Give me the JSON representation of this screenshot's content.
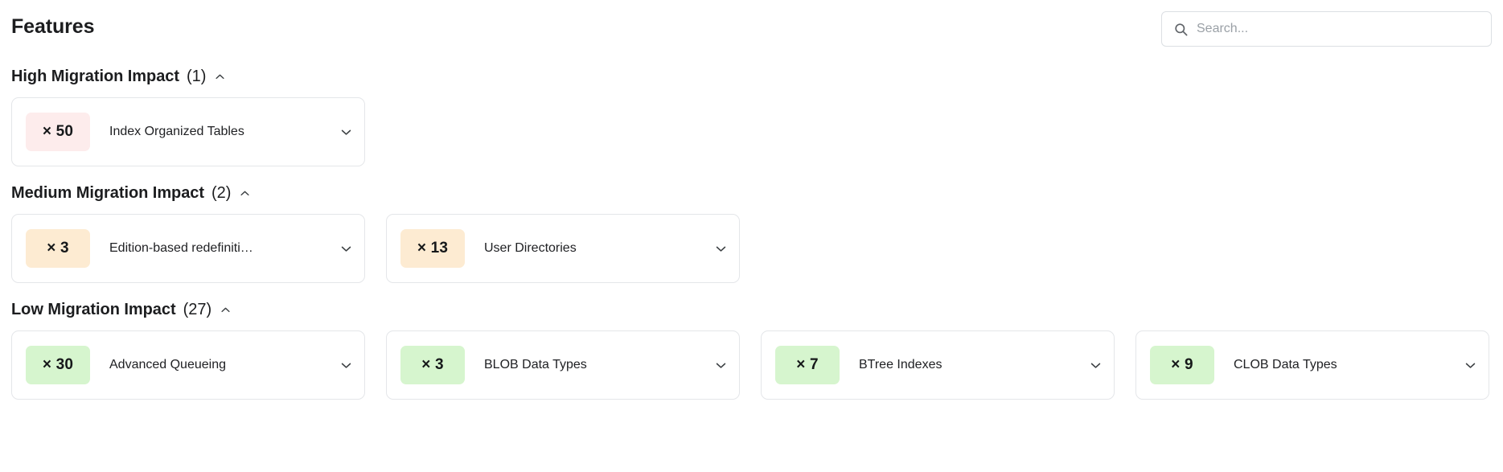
{
  "header": {
    "title": "Features",
    "search": {
      "placeholder": "Search...",
      "value": "",
      "icon": "search-icon"
    }
  },
  "colors": {
    "high_badge_bg": "#fdecec",
    "medium_badge_bg": "#fdebd2",
    "low_badge_bg": "#d6f5ce",
    "card_border": "#e4e6e9",
    "text_primary": "#202124"
  },
  "sections": [
    {
      "title": "High Migration Impact",
      "count": "(1)",
      "toggle_icon": "chevron-up-icon",
      "expanded": true,
      "severity": "high",
      "cards": [
        {
          "badge": "× 50",
          "label": "Index Organized Tables",
          "expand_icon": "chevron-down-icon"
        }
      ]
    },
    {
      "title": "Medium Migration Impact",
      "count": "(2)",
      "toggle_icon": "chevron-up-icon",
      "expanded": true,
      "severity": "medium",
      "cards": [
        {
          "badge": "× 3",
          "label": "Edition-based redefiniti…",
          "expand_icon": "chevron-down-icon"
        },
        {
          "badge": "× 13",
          "label": "User Directories",
          "expand_icon": "chevron-down-icon"
        }
      ]
    },
    {
      "title": "Low Migration Impact",
      "count": "(27)",
      "toggle_icon": "chevron-up-icon",
      "expanded": true,
      "severity": "low",
      "cards": [
        {
          "badge": "× 30",
          "label": "Advanced Queueing",
          "expand_icon": "chevron-down-icon"
        },
        {
          "badge": "× 3",
          "label": "BLOB Data Types",
          "expand_icon": "chevron-down-icon"
        },
        {
          "badge": "× 7",
          "label": "BTree Indexes",
          "expand_icon": "chevron-down-icon"
        },
        {
          "badge": "× 9",
          "label": "CLOB Data Types",
          "expand_icon": "chevron-down-icon"
        }
      ]
    }
  ]
}
